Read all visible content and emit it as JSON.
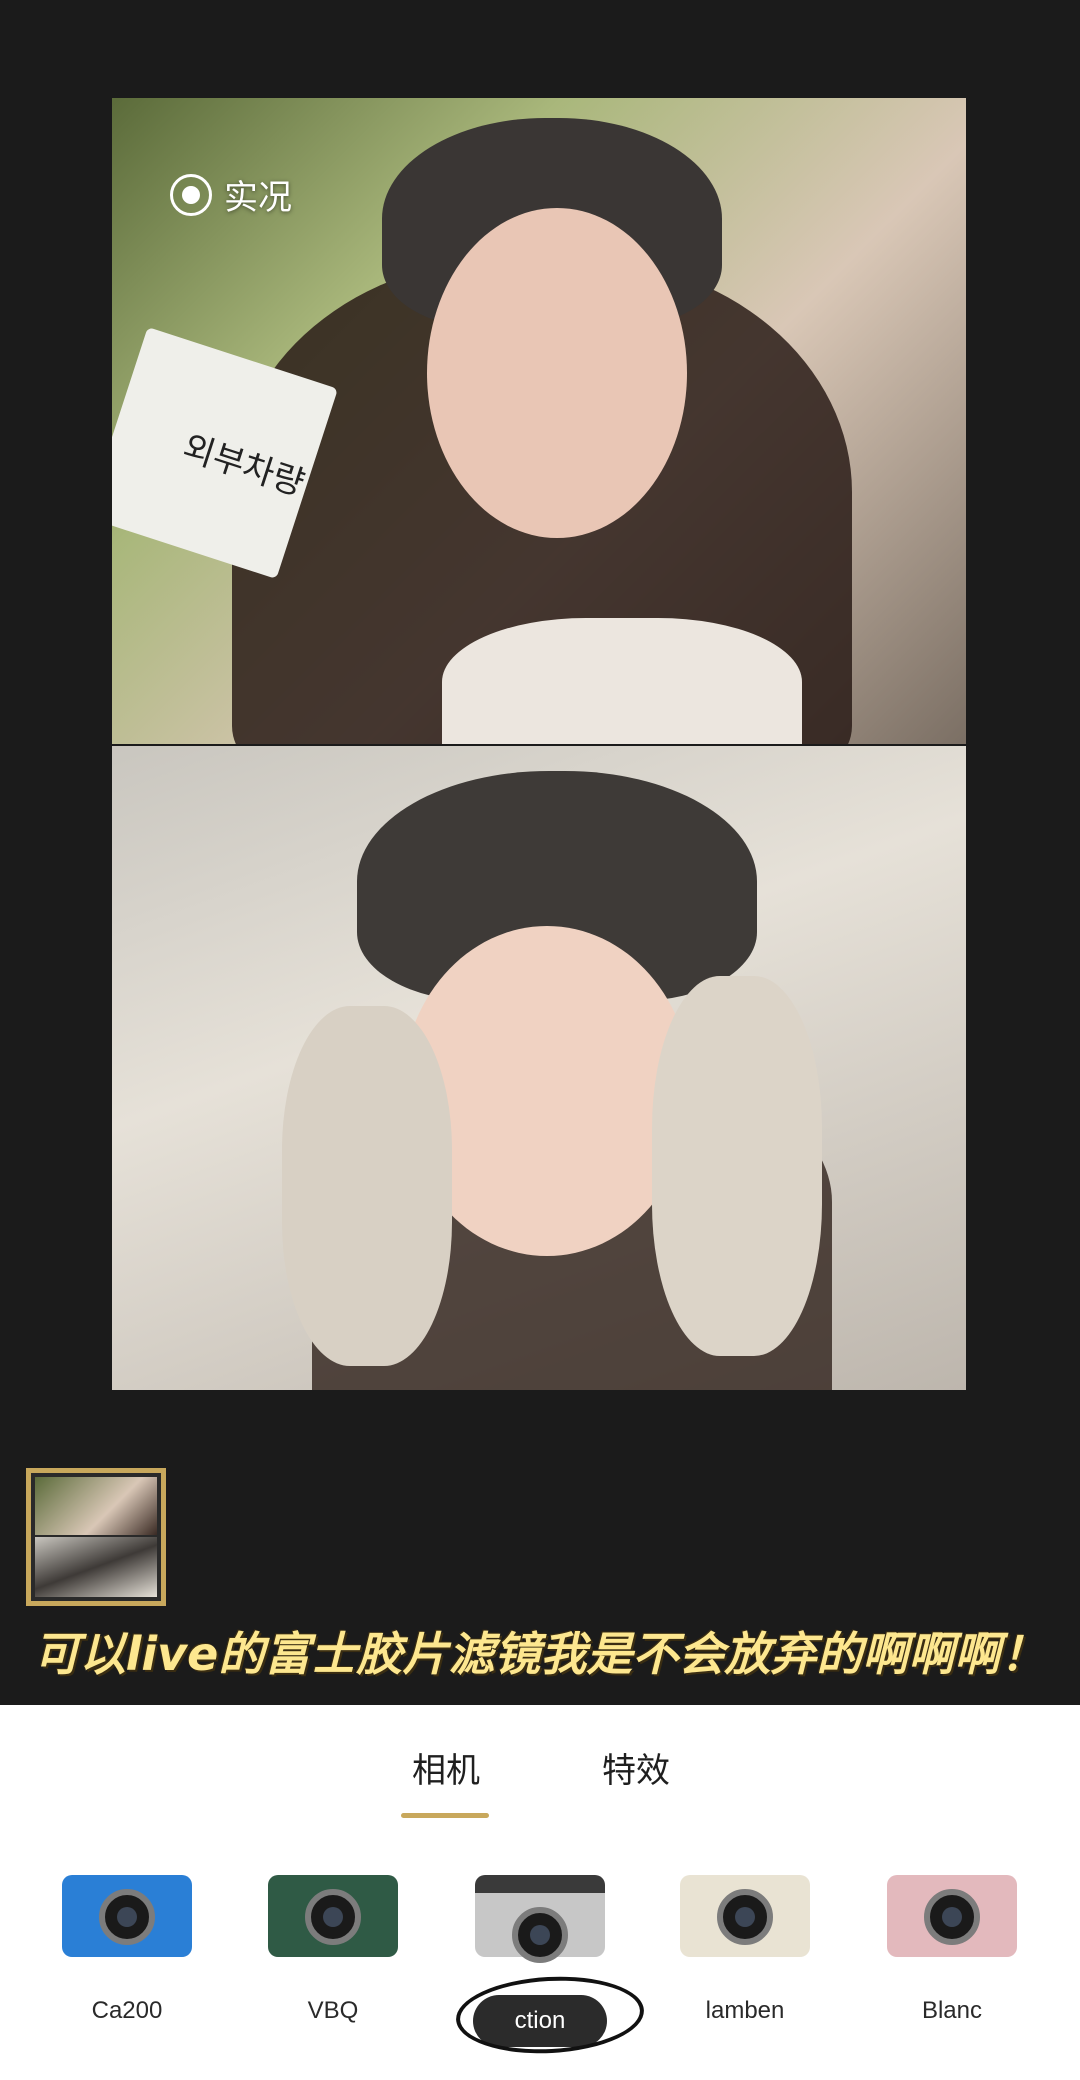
{
  "preview": {
    "live_label": "实况",
    "sign_text": "외부차량",
    "caption": "可以live的富士胶片滤镜我是不会放弃的啊啊啊！"
  },
  "tabs": [
    {
      "label": "相机",
      "selected": true
    },
    {
      "label": "特效",
      "selected": false
    }
  ],
  "cameras": [
    {
      "label": "Ca200",
      "color": "#2a7fd6",
      "selected": false
    },
    {
      "label": "VBQ",
      "color": "#2f5a45",
      "selected": false
    },
    {
      "label": "ction",
      "color": "#c7c7c7",
      "selected": true
    },
    {
      "label": "lamben",
      "color": "#e9e3d3",
      "selected": false
    },
    {
      "label": "Blanc",
      "color": "#e3b9bd",
      "selected": false
    }
  ],
  "colors": {
    "background": "#1b1b1b",
    "accent": "#c8a85c",
    "caption": "#fde78f"
  }
}
